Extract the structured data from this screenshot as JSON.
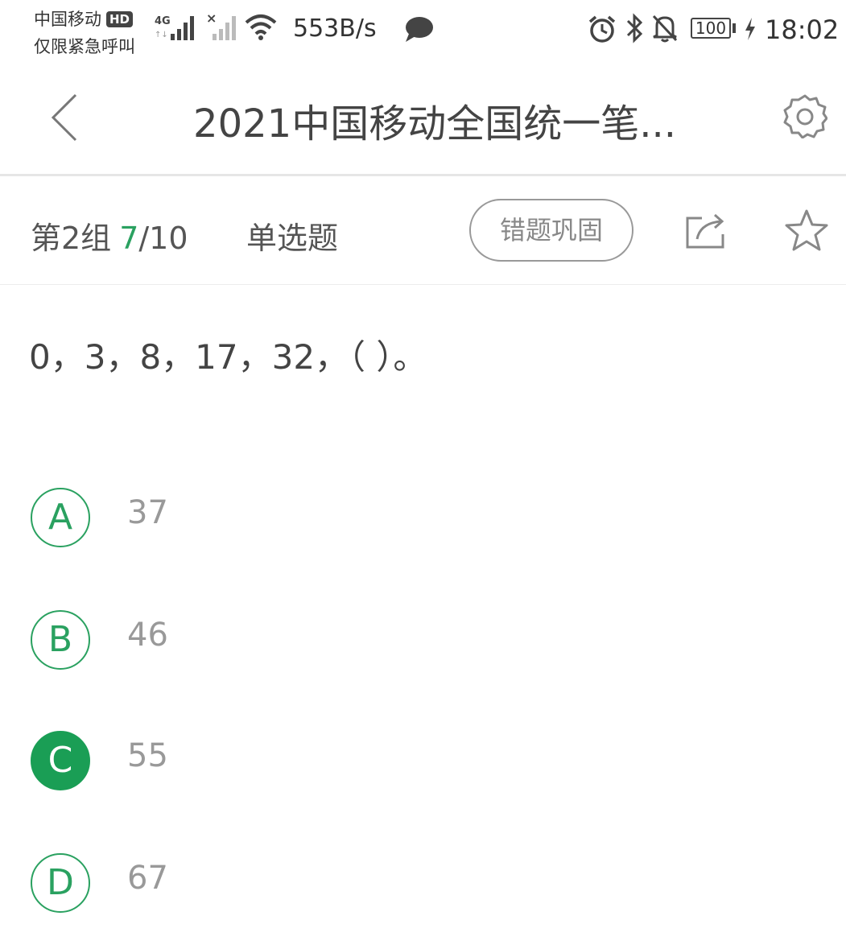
{
  "status_bar": {
    "carrier_line1": "中国移动",
    "hd_badge": "HD",
    "carrier_line2": "仅限紧急呼叫",
    "network_type": "4G",
    "net_speed": "553B/s",
    "battery": "100",
    "time": "18:02",
    "icons": [
      "signal-icon",
      "no-signal-icon",
      "wifi-icon",
      "message-icon",
      "alarm-icon",
      "bluetooth-icon",
      "mute-icon",
      "charging-icon"
    ]
  },
  "header": {
    "title": "2021中国移动全国统一笔...",
    "back_icon": "chevron-left-icon",
    "settings_icon": "gear-icon"
  },
  "meta": {
    "group_label": "第2组",
    "progress_current": "7",
    "progress_total": "/10",
    "question_type": "单选题",
    "consolidate_button": "错题巩固"
  },
  "question": {
    "text": "0，3，8，17，32，（ ）。"
  },
  "options": [
    {
      "letter": "A",
      "text": "37",
      "selected": false
    },
    {
      "letter": "B",
      "text": "46",
      "selected": false
    },
    {
      "letter": "C",
      "text": "55",
      "selected": true
    },
    {
      "letter": "D",
      "text": "67",
      "selected": false
    }
  ],
  "colors": {
    "accent": "#2aa160",
    "selected": "#1a9e55",
    "option_text": "#999999"
  }
}
